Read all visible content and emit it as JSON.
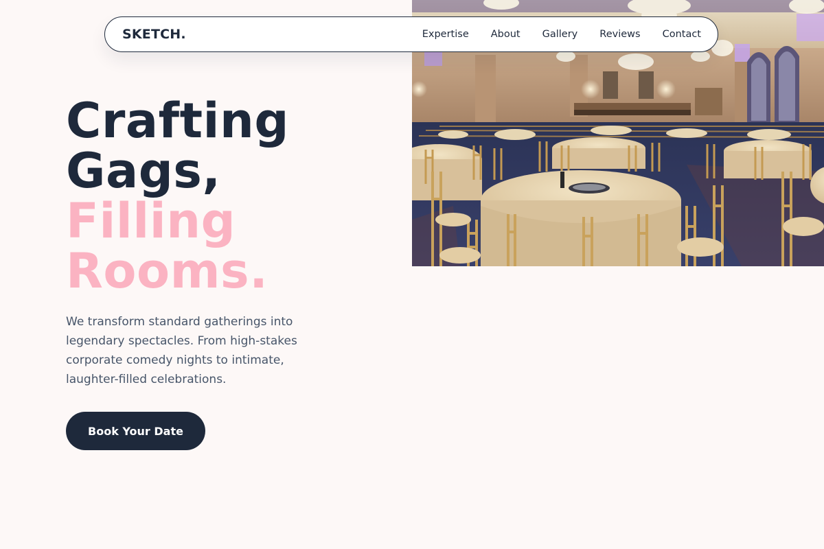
{
  "colors": {
    "page_background": "#fdf8f7",
    "primary_dark": "#1e293b",
    "accent_pink": "#fbb3c2",
    "body_text": "#475569"
  },
  "nav": {
    "brand": "SKETCH.",
    "links": [
      {
        "label": "Expertise"
      },
      {
        "label": "About"
      },
      {
        "label": "Gallery"
      },
      {
        "label": "Reviews"
      },
      {
        "label": "Contact"
      }
    ]
  },
  "hero": {
    "headline_dark": [
      "Crafting",
      "Gags,"
    ],
    "headline_pink": [
      "Filling",
      "Rooms."
    ],
    "description": "We transform standard gatherings into legendary spectacles. From high-stakes corporate comedy nights to intimate, laughter-filled celebrations.",
    "cta_label": "Book Your Date",
    "image_subject": "ballroom-with-round-tables-gold-chairs-chandeliers"
  }
}
